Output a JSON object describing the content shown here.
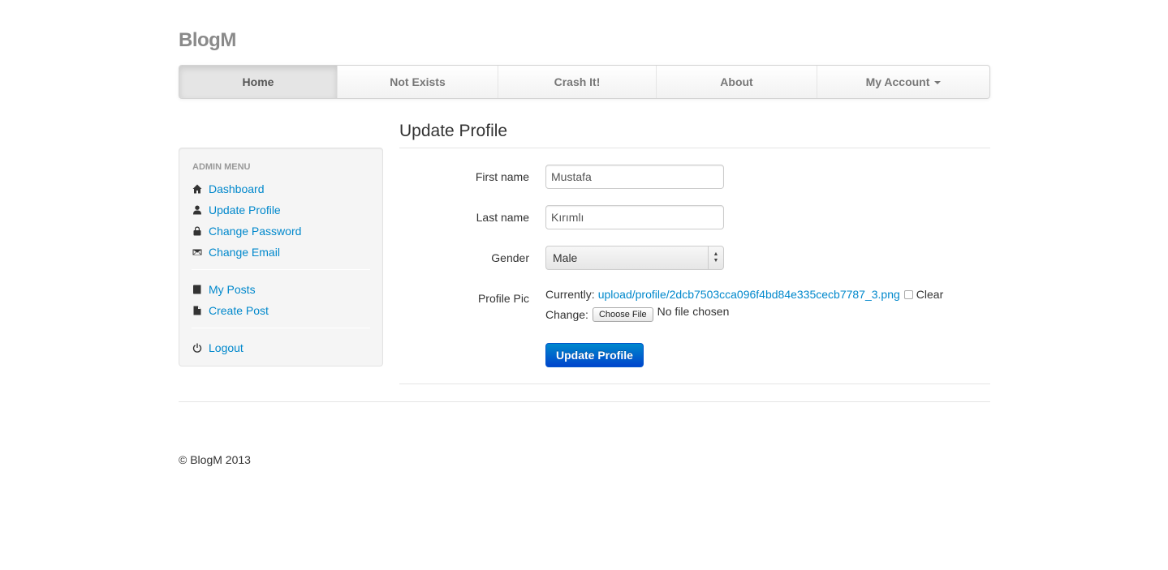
{
  "brand": "BlogM",
  "navbar": {
    "items": [
      {
        "label": "Home"
      },
      {
        "label": "Not Exists"
      },
      {
        "label": "Crash It!"
      },
      {
        "label": "About"
      },
      {
        "label": "My Account"
      }
    ],
    "active": "Home"
  },
  "sidebar": {
    "header": "ADMIN MENU",
    "items": [
      {
        "label": "Dashboard",
        "icon": "home-icon"
      },
      {
        "label": "Update Profile",
        "icon": "user-icon"
      },
      {
        "label": "Change Password",
        "icon": "lock-icon"
      },
      {
        "label": "Change Email",
        "icon": "envelope-icon"
      },
      {
        "label": "My Posts",
        "icon": "book-icon"
      },
      {
        "label": "Create Post",
        "icon": "file-icon"
      },
      {
        "label": "Logout",
        "icon": "power-icon"
      }
    ]
  },
  "form": {
    "title": "Update Profile",
    "first_name": {
      "label": "First name",
      "value": "Mustafa"
    },
    "last_name": {
      "label": "Last name",
      "value": "Kırımlı"
    },
    "gender": {
      "label": "Gender",
      "value": "Male"
    },
    "profile_pic": {
      "label": "Profile Pic",
      "currently_label": "Currently:",
      "current_file": "upload/profile/2dcb7503cca096f4bd84e335cecb7787_3.png",
      "clear_label": "Clear",
      "change_label": "Change:",
      "choose_file_label": "Choose File",
      "no_file_text": "No file chosen"
    },
    "submit_label": "Update Profile"
  },
  "footer": {
    "text": "© BlogM 2013"
  },
  "colors": {
    "link": "#0088cc",
    "primary_button": "#0055cc",
    "brand": "#8a8a8a"
  }
}
